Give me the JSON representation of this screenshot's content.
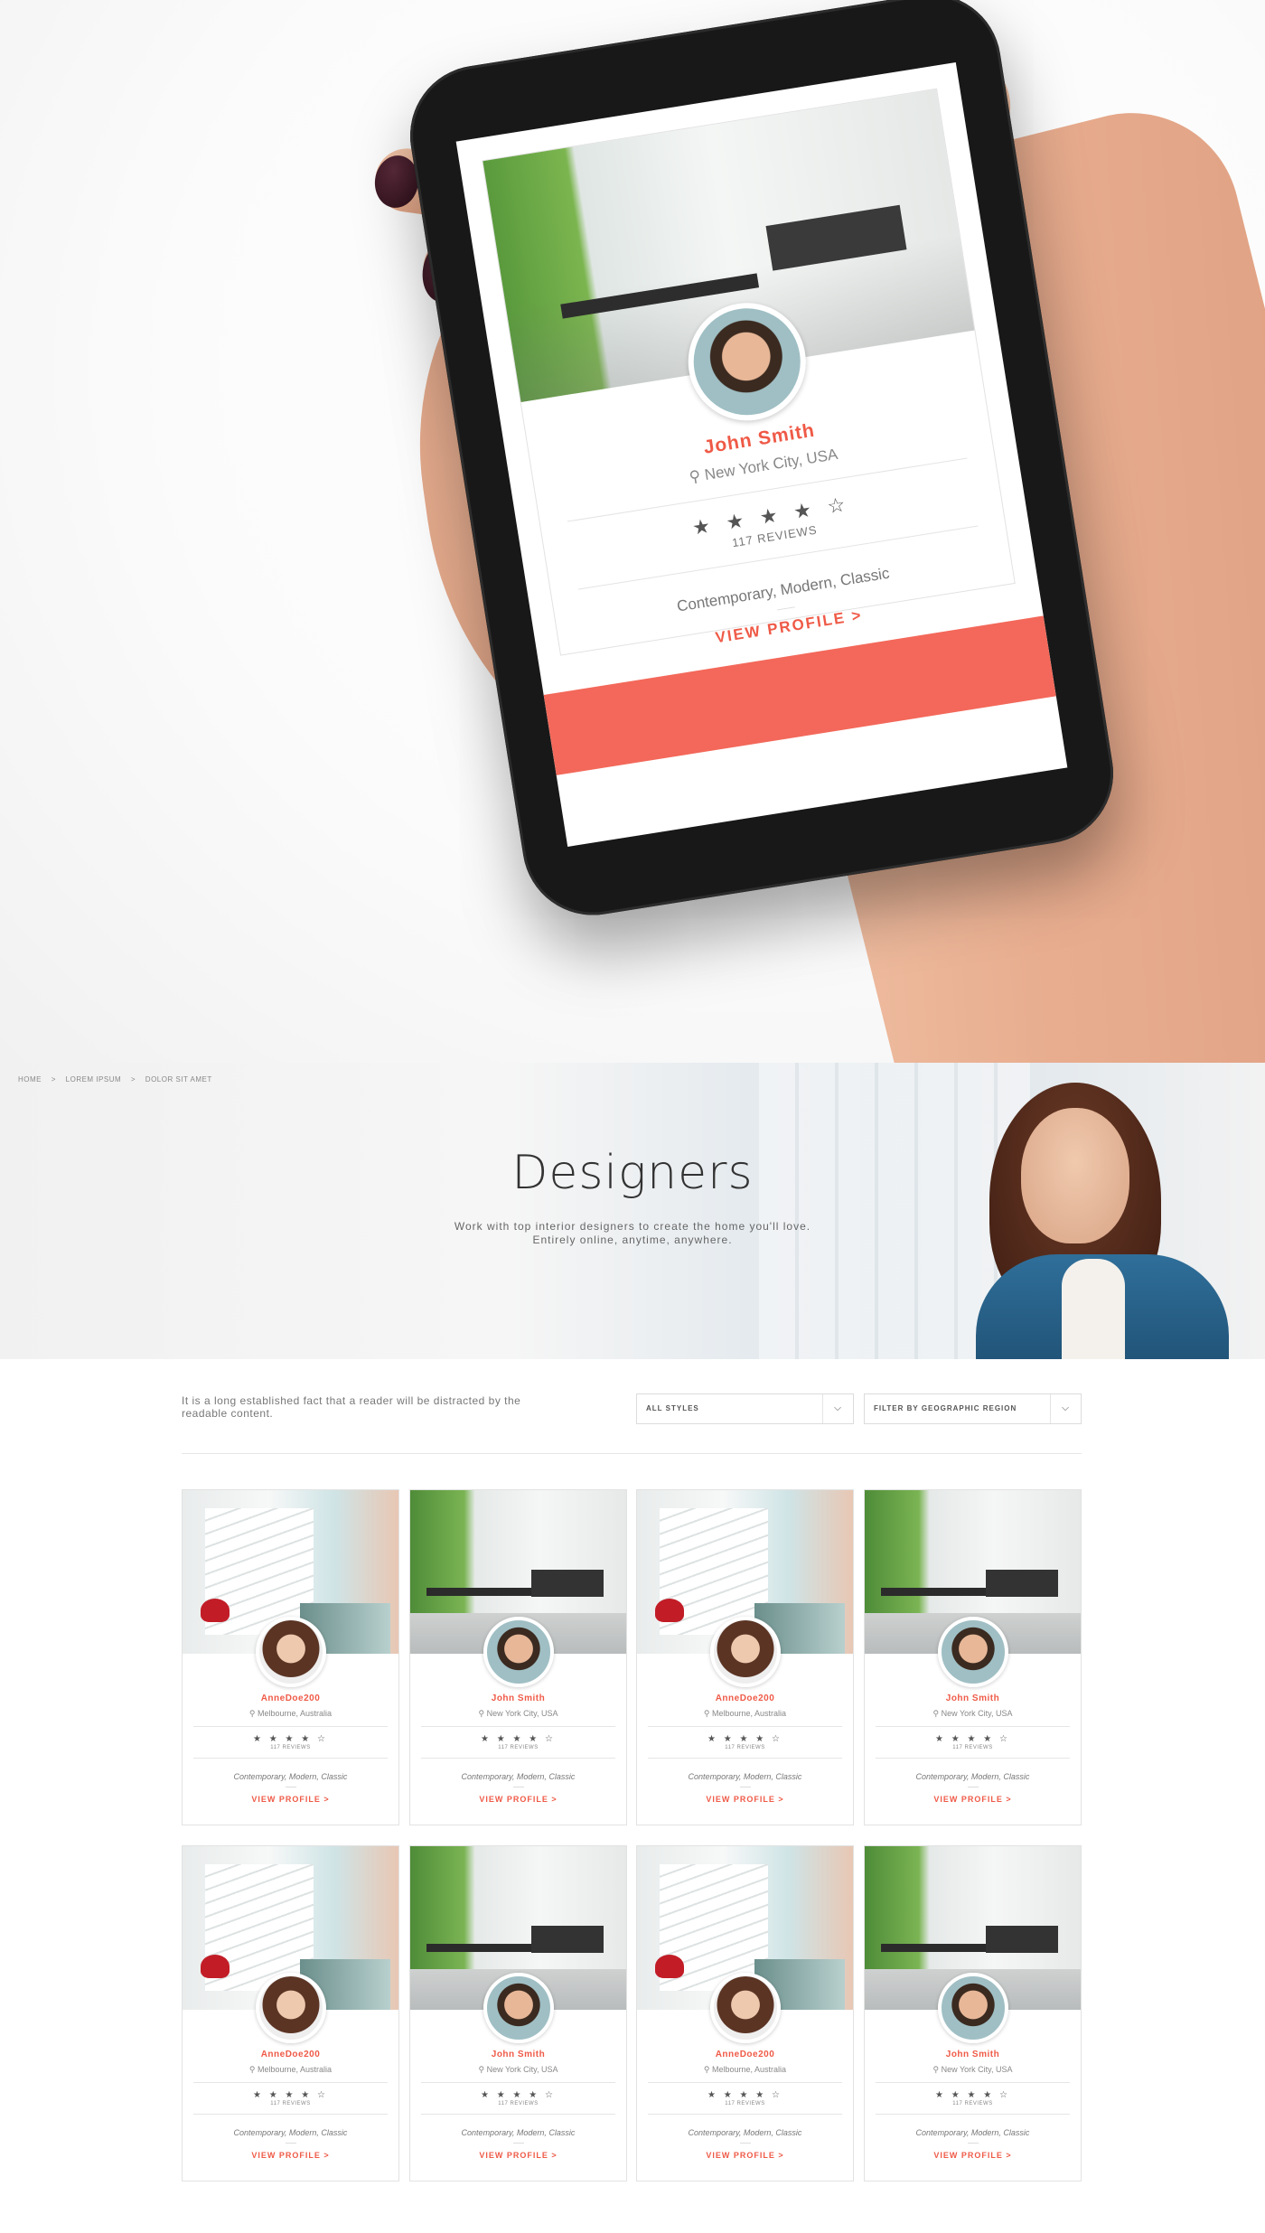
{
  "phone_profile": {
    "name": "John Smith",
    "location": "New York City, USA",
    "stars": "★ ★ ★ ★ ☆",
    "reviews": "117 REVIEWS",
    "styles": "Contemporary, Modern, Classic",
    "view_label": "VIEW PROFILE >"
  },
  "breadcrumb": [
    "HOME",
    ">",
    "LOREM IPSUM",
    ">",
    "DOLOR SIT AMET"
  ],
  "banner": {
    "title": "Designers",
    "subtitle_line1": "Work with top interior designers to create the home you'll love.",
    "subtitle_line2": "Entirely online, anytime, anywhere."
  },
  "filters": {
    "intro": "It is a long established fact that a reader will be distracted by the readable content.",
    "style_select": "ALL STYLES",
    "region_select": "FILTER BY GEOGRAPHIC REGION"
  },
  "designers": [
    {
      "name": "AnneDoe200",
      "location": "Melbourne, Australia",
      "stars": "★ ★ ★ ★ ☆",
      "reviews": "117 REVIEWS",
      "styles": "Contemporary, Modern, Classic",
      "view": "VIEW PROFILE >"
    },
    {
      "name": "John Smith",
      "location": "New York City, USA",
      "stars": "★ ★ ★ ★ ☆",
      "reviews": "117 REVIEWS",
      "styles": "Contemporary, Modern, Classic",
      "view": "VIEW PROFILE >"
    },
    {
      "name": "AnneDoe200",
      "location": "Melbourne, Australia",
      "stars": "★ ★ ★ ★ ☆",
      "reviews": "117 REVIEWS",
      "styles": "Contemporary, Modern, Classic",
      "view": "VIEW PROFILE >"
    },
    {
      "name": "John Smith",
      "location": "New York City, USA",
      "stars": "★ ★ ★ ★ ☆",
      "reviews": "117 REVIEWS",
      "styles": "Contemporary, Modern, Classic",
      "view": "VIEW PROFILE >"
    },
    {
      "name": "AnneDoe200",
      "location": "Melbourne, Australia",
      "stars": "★ ★ ★ ★ ☆",
      "reviews": "117 REVIEWS",
      "styles": "Contemporary, Modern, Classic",
      "view": "VIEW PROFILE >"
    },
    {
      "name": "John Smith",
      "location": "New York City, USA",
      "stars": "★ ★ ★ ★ ☆",
      "reviews": "117 REVIEWS",
      "styles": "Contemporary, Modern, Classic",
      "view": "VIEW PROFILE >"
    },
    {
      "name": "AnneDoe200",
      "location": "Melbourne, Australia",
      "stars": "★ ★ ★ ★ ☆",
      "reviews": "117 REVIEWS",
      "styles": "Contemporary, Modern, Classic",
      "view": "VIEW PROFILE >"
    },
    {
      "name": "John Smith",
      "location": "New York City, USA",
      "stars": "★ ★ ★ ★ ☆",
      "reviews": "117 REVIEWS",
      "styles": "Contemporary, Modern, Classic",
      "view": "VIEW PROFILE >"
    }
  ],
  "colors": {
    "accent": "#ef5a47",
    "footer_bar": "#f3685a"
  },
  "icons": {
    "location": "map-pin-icon",
    "select_arrow": "chevron-down-icon",
    "rating": "star-icon"
  }
}
